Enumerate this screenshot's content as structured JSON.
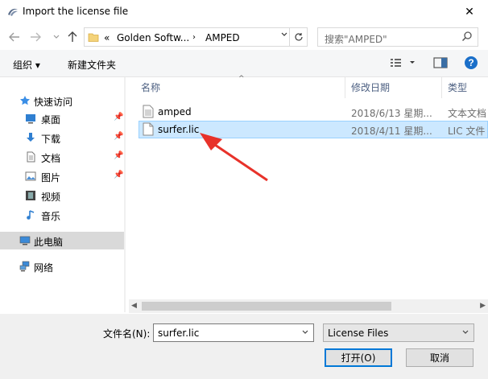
{
  "window": {
    "title": "Import the license file",
    "close_glyph": "✕"
  },
  "navbar": {
    "breadcrumb_prefix": "«",
    "crumbs": [
      "Golden Softw...",
      "AMPED"
    ],
    "search_placeholder": "搜索\"AMPED\""
  },
  "toolbar": {
    "organize": "组织 ▾",
    "new_folder": "新建文件夹"
  },
  "sidebar": {
    "items": [
      {
        "label": "快速访问",
        "icon": "star-icon",
        "pinned": false
      },
      {
        "label": "桌面",
        "icon": "desktop-icon",
        "pinned": true
      },
      {
        "label": "下载",
        "icon": "download-icon",
        "pinned": true
      },
      {
        "label": "文档",
        "icon": "document-icon",
        "pinned": true
      },
      {
        "label": "图片",
        "icon": "picture-icon",
        "pinned": true
      },
      {
        "label": "视频",
        "icon": "video-icon",
        "pinned": false
      },
      {
        "label": "音乐",
        "icon": "music-icon",
        "pinned": false
      },
      {
        "label": "此电脑",
        "icon": "computer-icon",
        "pinned": false
      },
      {
        "label": "网络",
        "icon": "network-icon",
        "pinned": false
      }
    ]
  },
  "columns": {
    "name": "名称",
    "modified": "修改日期",
    "type": "类型"
  },
  "files": [
    {
      "name": "amped",
      "modified": "2018/6/13 星期...",
      "type": "文本文档",
      "selected": false
    },
    {
      "name": "surfer.lic",
      "modified": "2018/4/11 星期...",
      "type": "LIC 文件",
      "selected": true
    }
  ],
  "footer": {
    "filename_label": "文件名(N):",
    "filename_value": "surfer.lic",
    "filetype_value": "License Files",
    "open_button": "打开(O)",
    "cancel_button": "取消"
  },
  "colors": {
    "selection": "#cce8ff",
    "selection_border": "#99d1ff",
    "accent": "#0078d7",
    "annotation_arrow": "#e8322a"
  }
}
